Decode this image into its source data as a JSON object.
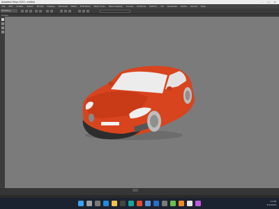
{
  "window": {
    "title": "Autodesk Maya 2023: untitled"
  },
  "menubar": {
    "items": [
      "File",
      "Edit",
      "Create",
      "Select",
      "Modify",
      "Display",
      "Windows",
      "Mesh",
      "Edit Mesh",
      "Mesh Tools",
      "Mesh Display",
      "Curves",
      "Surfaces",
      "Deform",
      "UV",
      "Generate",
      "Cache",
      "Arnold",
      "Help"
    ]
  },
  "statusline": {
    "mode": "Modeling"
  },
  "shelf": {
    "tab": "Curves"
  },
  "taskbar": {
    "time": "11:48",
    "date": "5/1/2023"
  },
  "colors": {
    "car_body": "#d8441e",
    "viewport_bg": "#7b7b7b",
    "taskbar_bg": "#1c2330"
  }
}
